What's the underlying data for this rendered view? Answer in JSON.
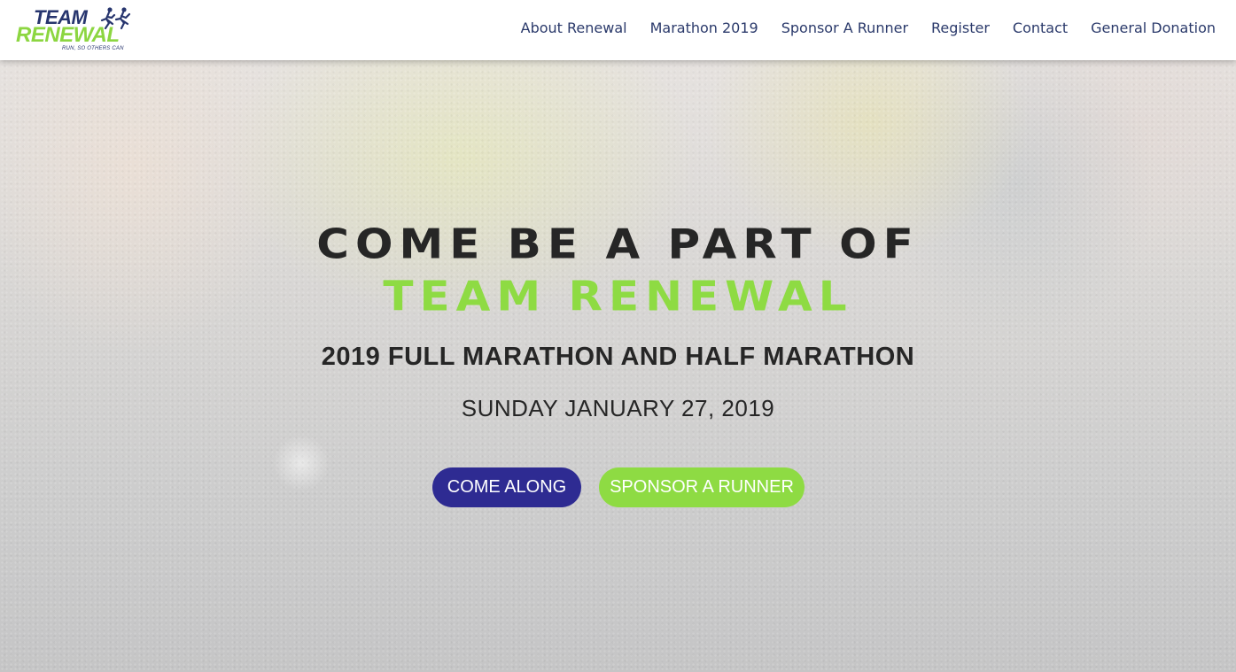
{
  "brand": {
    "logo_top": "TEAM",
    "logo_bottom": "RENEWAL",
    "tagline": "RUN, SO OTHERS CAN",
    "colors": {
      "navy": "#27356e",
      "green": "#8edb43",
      "button_blue": "#2e2b92"
    }
  },
  "nav": {
    "items": [
      {
        "label": "About Renewal"
      },
      {
        "label": "Marathon 2019"
      },
      {
        "label": "Sponsor A Runner"
      },
      {
        "label": "Register"
      },
      {
        "label": "Contact"
      },
      {
        "label": "General Donation"
      }
    ]
  },
  "hero": {
    "headline_line1": "COME BE A PART OF",
    "headline_line2": "TEAM RENEWAL",
    "subheading": "2019 FULL MARATHON AND HALF MARATHON",
    "date": "SUNDAY JANUARY 27, 2019",
    "buttons": {
      "come_along": "COME ALONG",
      "sponsor": "SPONSOR A RUNNER"
    }
  }
}
